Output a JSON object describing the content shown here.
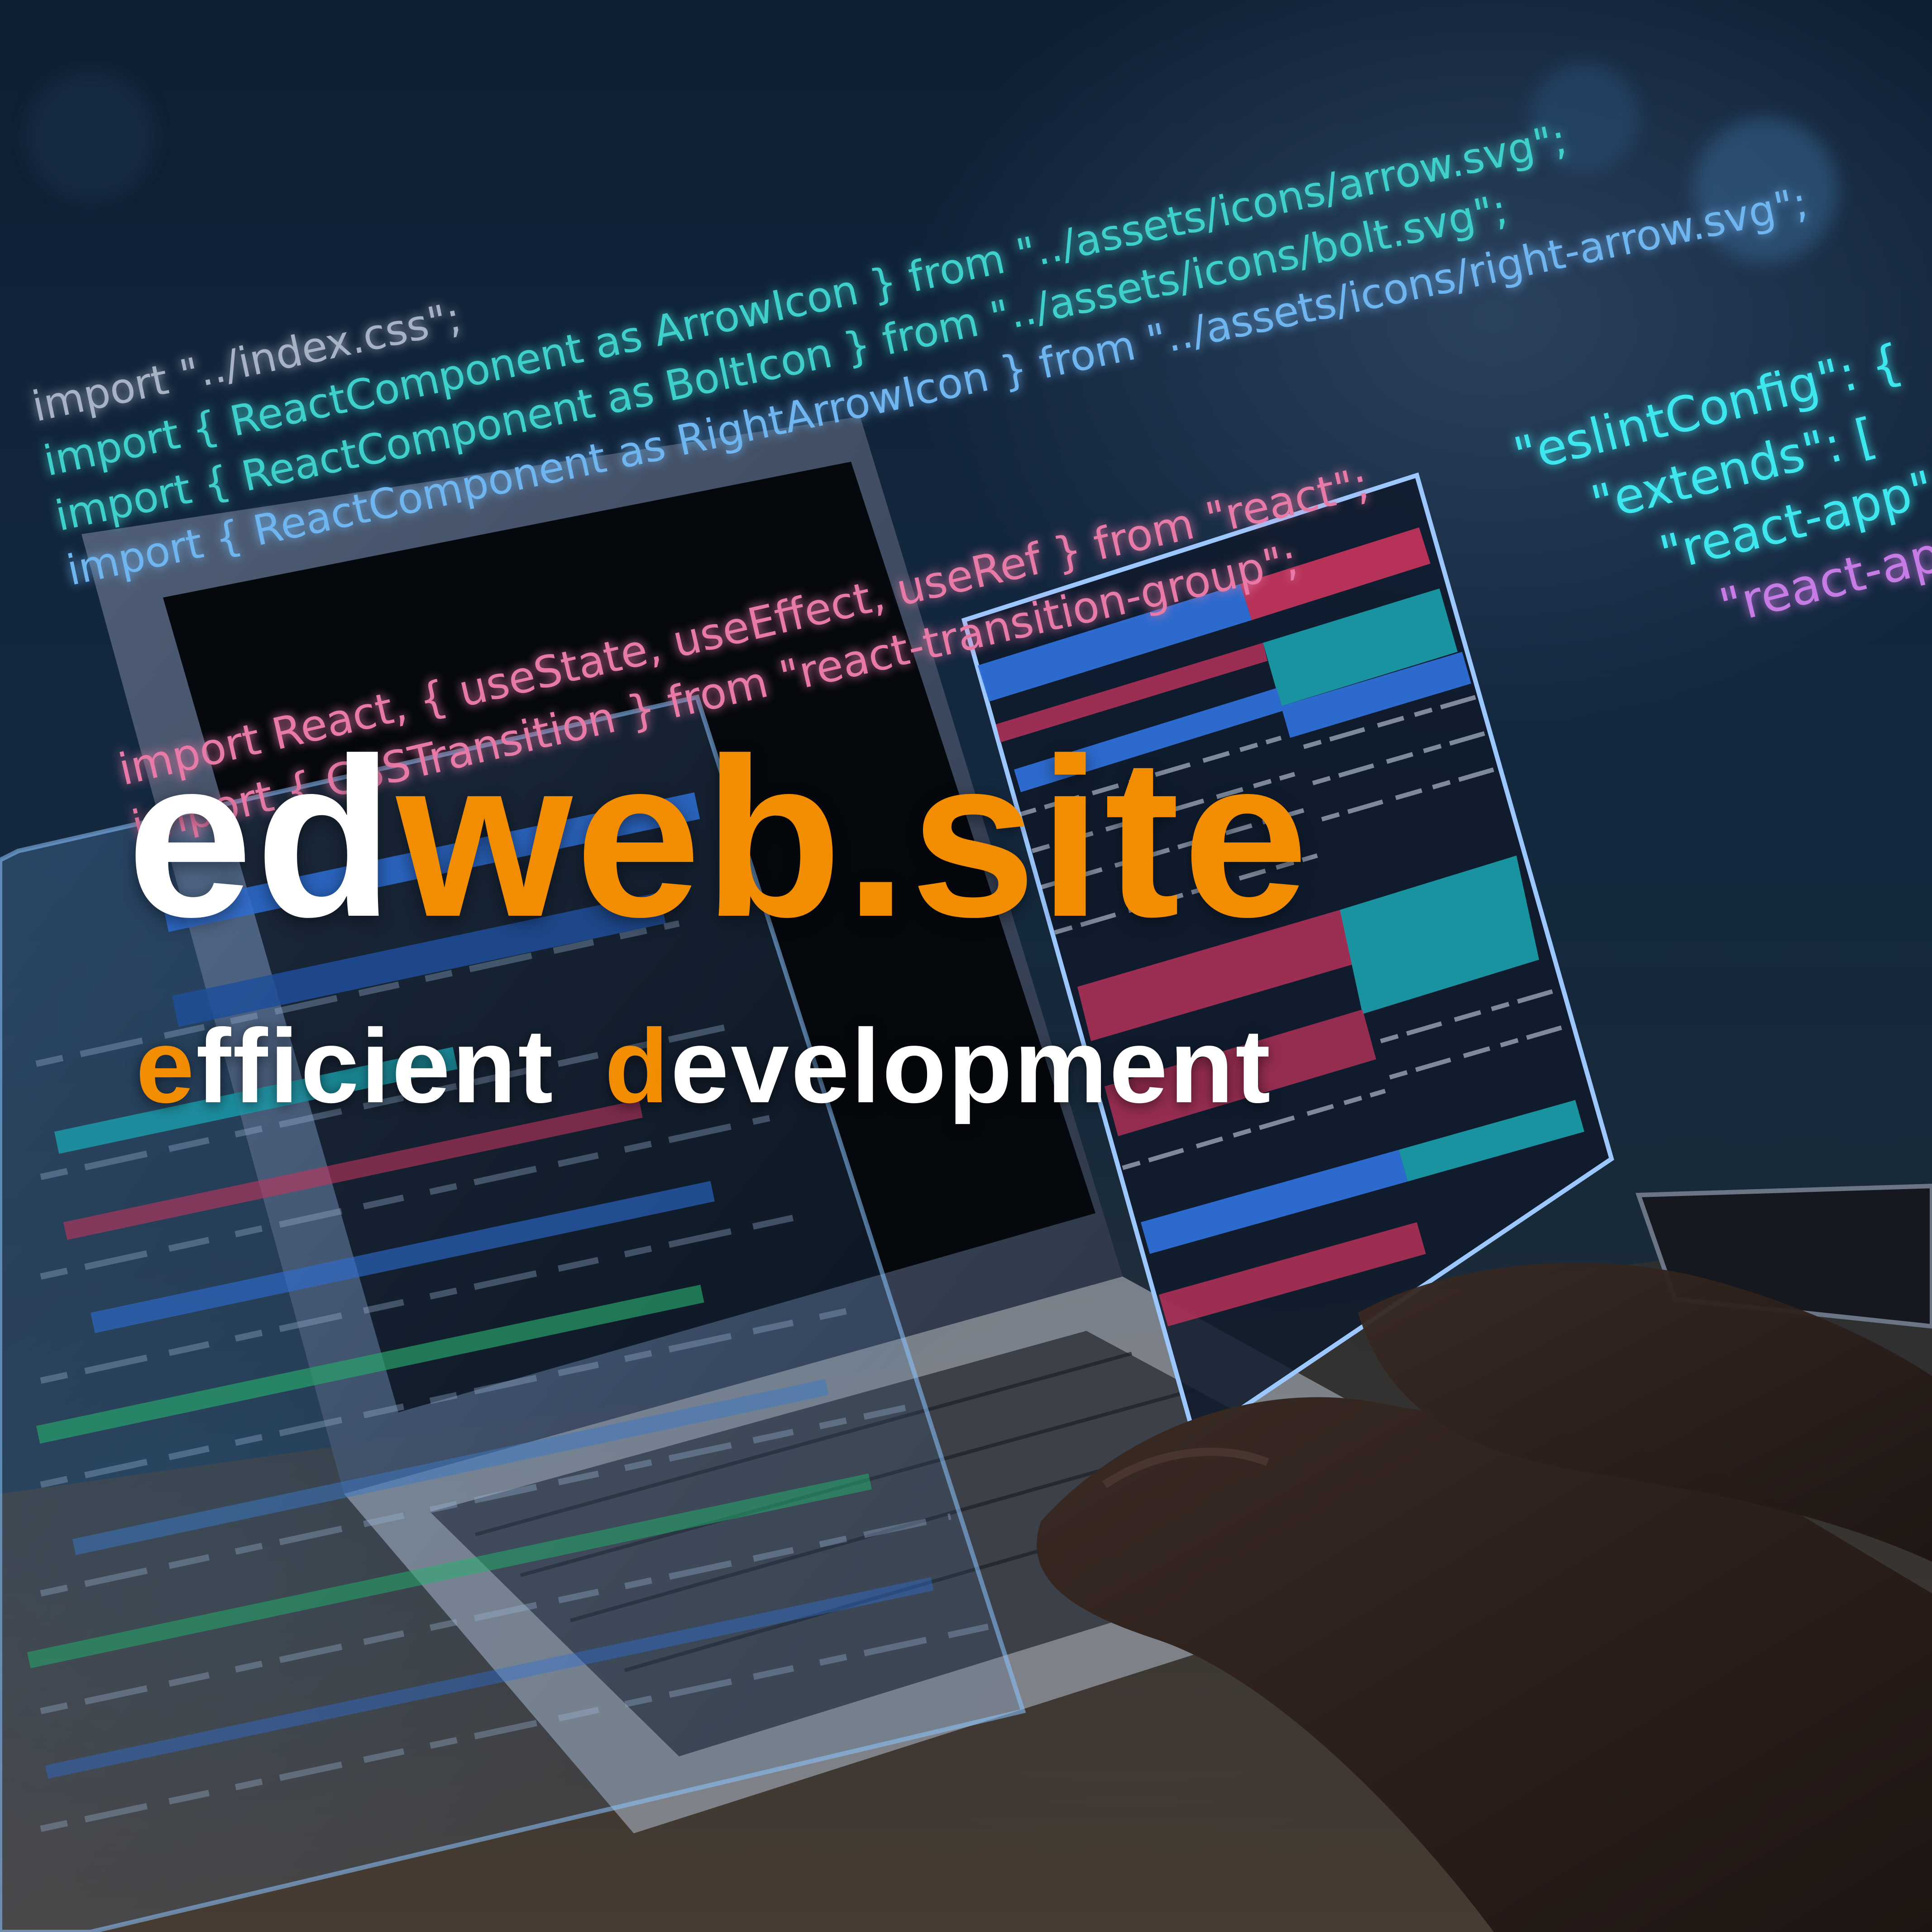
{
  "logo": {
    "part_ed": "ed",
    "part_web": "web",
    "part_dot": ".",
    "part_site": "site",
    "color_white": "#ffffff",
    "color_orange": "#f28c00"
  },
  "tagline": {
    "e_initial": "e",
    "e_rest": "fficient",
    "d_initial": "d",
    "d_rest": "evelopment"
  },
  "code_overlay_left": [
    "import \"../index.css\";",
    "import { ReactComponent as ArrowIcon } from \"../assets/icons/arrow.svg\";",
    "import { ReactComponent as BoltIcon } from \"../assets/icons/bolt.svg\";",
    "import { ReactComponent as RightArrowIcon } from \"../assets/icons/right-arrow.svg\";"
  ],
  "code_overlay_left2": [
    "import React, { useState, useEffect, useRef } from \"react\";",
    "import { CSSTransition } from \"react-transition-group\";"
  ],
  "code_overlay_right": [
    "\"eslintConfig\": {",
    "\"extends\": [",
    "\"react-app\",",
    "\"react-app/\""
  ],
  "scene": {
    "subject": "hands typing on a laptop with floating code editor panels",
    "code_panel_colors": [
      "#2f6fd6",
      "#c0345c",
      "#1c9aa8",
      "#101a2a"
    ]
  }
}
